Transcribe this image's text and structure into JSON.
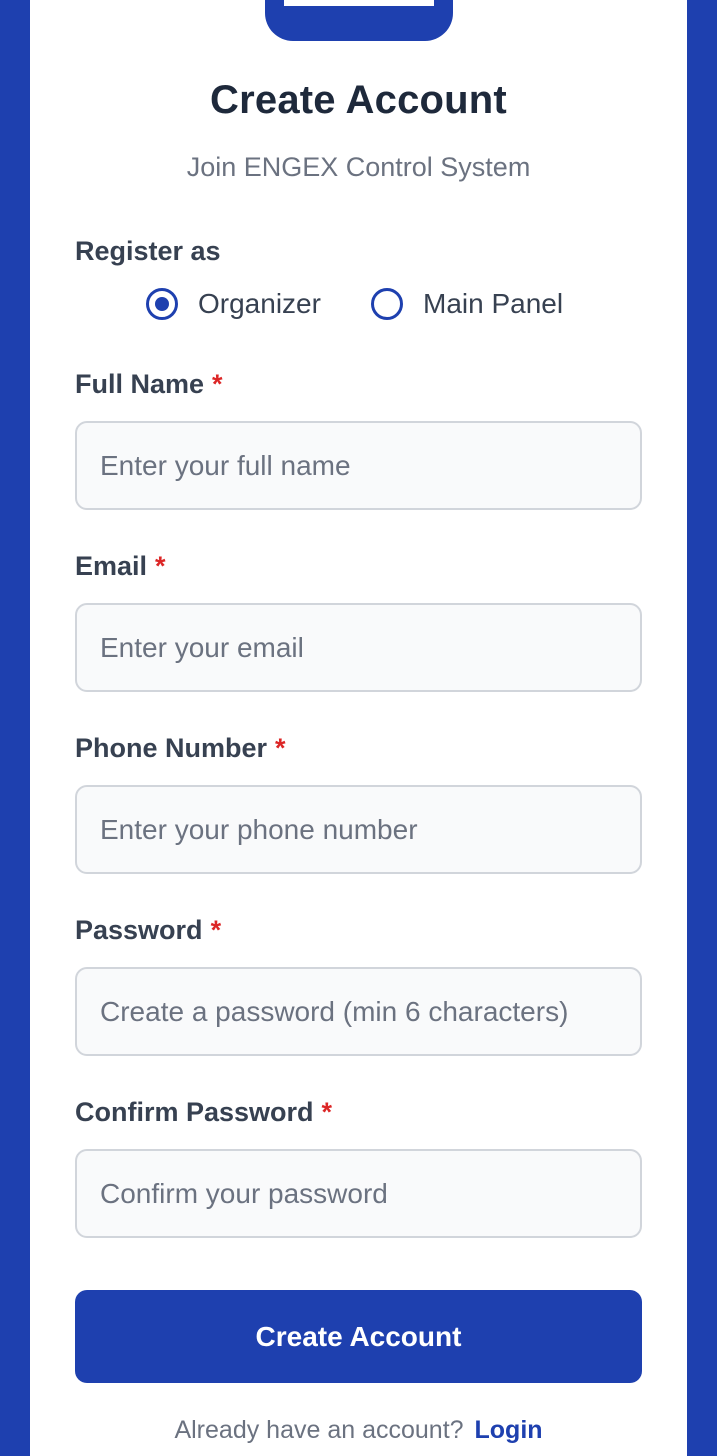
{
  "header": {
    "title": "Create Account",
    "subtitle": "Join ENGEX Control System"
  },
  "register_as": {
    "label": "Register as",
    "options": [
      {
        "label": "Organizer",
        "selected": true
      },
      {
        "label": "Main Panel",
        "selected": false
      }
    ]
  },
  "fields": [
    {
      "label": "Full Name",
      "required_mark": "*",
      "placeholder": "Enter your full name",
      "value": ""
    },
    {
      "label": "Email",
      "required_mark": "*",
      "placeholder": "Enter your email",
      "value": ""
    },
    {
      "label": "Phone Number",
      "required_mark": "*",
      "placeholder": "Enter your phone number",
      "value": ""
    },
    {
      "label": "Password",
      "required_mark": "*",
      "placeholder": "Create a password (min 6 characters)",
      "value": ""
    },
    {
      "label": "Confirm Password",
      "required_mark": "*",
      "placeholder": "Confirm your password",
      "value": ""
    }
  ],
  "submit_label": "Create Account",
  "footer": {
    "prompt": "Already have an account?",
    "link_label": "Login"
  },
  "colors": {
    "brand": "#1e40af",
    "heading": "#1e293b",
    "required": "#dc2626"
  }
}
